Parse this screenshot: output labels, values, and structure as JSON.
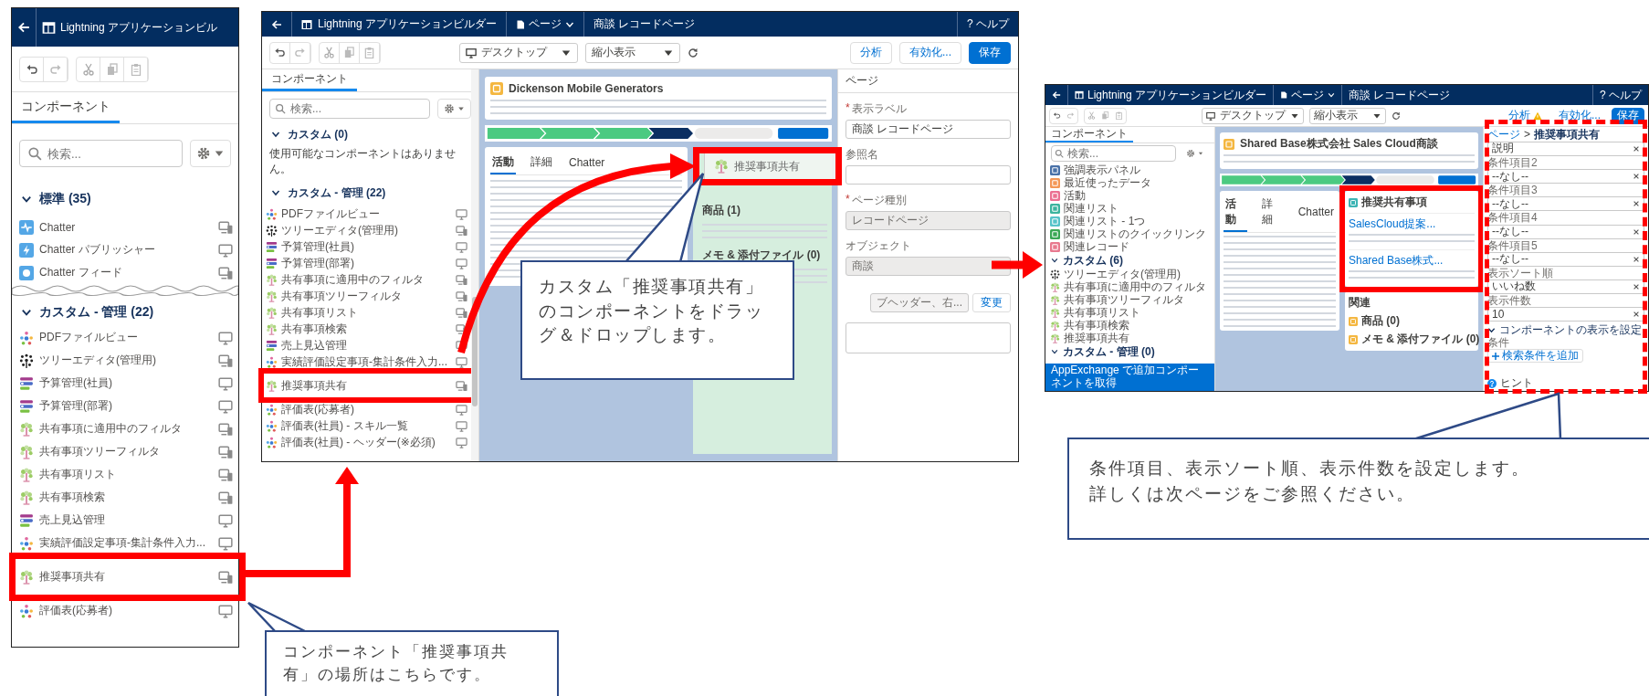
{
  "panel_a": {
    "header": {
      "title": "Lightning アプリケーションビル"
    },
    "tabs": [
      {
        "label": "コンポーネント",
        "selected": true
      }
    ],
    "search": {
      "placeholder": "検索..."
    },
    "sections": [
      {
        "title": "標準 (35)",
        "expanded": true,
        "items": [
          {
            "label": "Chatter",
            "kind": "chatter",
            "mobile": true,
            "highlighted": false
          },
          {
            "label": "Chatter パブリッシャー",
            "kind": "bolt",
            "mobile": false,
            "highlighted": false
          },
          {
            "label": "Chatter フィード",
            "kind": "feed",
            "mobile": true,
            "highlighted": false
          }
        ]
      },
      {
        "title": "カスタム - 管理 (22)",
        "expanded": true,
        "items": [
          {
            "label": "PDFファイルビュー",
            "kind": "org",
            "mobile": false,
            "highlighted": false
          },
          {
            "label": "ツリーエディタ(管理用)",
            "kind": "dots",
            "mobile": true,
            "highlighted": false
          },
          {
            "label": "予算管理(社員)",
            "kind": "bars",
            "mobile": false,
            "highlighted": false
          },
          {
            "label": "予算管理(部署)",
            "kind": "bars",
            "mobile": false,
            "highlighted": false
          },
          {
            "label": "共有事項に適用中のフィルタ",
            "kind": "sprout",
            "mobile": true,
            "highlighted": false
          },
          {
            "label": "共有事項ツリーフィルタ",
            "kind": "sprout",
            "mobile": true,
            "highlighted": false
          },
          {
            "label": "共有事項リスト",
            "kind": "sprout",
            "mobile": true,
            "highlighted": false
          },
          {
            "label": "共有事項検索",
            "kind": "sprout",
            "mobile": true,
            "highlighted": false
          },
          {
            "label": "売上見込管理",
            "kind": "bars",
            "mobile": false,
            "highlighted": false
          },
          {
            "label": "実績評価設定事項-集計条件入力...",
            "kind": "org",
            "mobile": false,
            "highlighted": false
          },
          {
            "label": "推奨事項共有",
            "kind": "sprout",
            "mobile": true,
            "highlighted": true
          },
          {
            "label": "評価表(応募者)",
            "kind": "org",
            "mobile": false,
            "highlighted": false
          }
        ]
      }
    ]
  },
  "panel_b": {
    "header": {
      "app_title": "Lightning アプリケーションビルダー",
      "menu": "ページ",
      "page": "商談 レコードページ",
      "help_icon": "?",
      "help": "ヘルプ"
    },
    "toolbar": {
      "device": "デスクトップ",
      "zoom": "縮小表示",
      "buttons": [
        {
          "label": "分析",
          "kind": "neutral",
          "warning": false
        },
        {
          "label": "有効化...",
          "kind": "neutral",
          "warning": false
        },
        {
          "label": "保存",
          "kind": "brand",
          "warning": false
        }
      ]
    },
    "sidebar": {
      "tabs": [
        {
          "label": "コンポーネント",
          "selected": true
        }
      ],
      "search": {
        "placeholder": "検索..."
      },
      "sections": [
        {
          "title": "カスタム (0)",
          "expanded": true,
          "empty_text": "使用可能なコンポーネントはありません。"
        },
        {
          "title": "カスタム - 管理 (22)",
          "expanded": true,
          "items": [
            {
              "label": "PDFファイルビュー",
              "kind": "org",
              "mobile": false,
              "highlighted": false
            },
            {
              "label": "ツリーエディタ(管理用)",
              "kind": "dots",
              "mobile": true,
              "highlighted": false
            },
            {
              "label": "予算管理(社員)",
              "kind": "bars",
              "mobile": false,
              "highlighted": false
            },
            {
              "label": "予算管理(部署)",
              "kind": "bars",
              "mobile": false,
              "highlighted": false
            },
            {
              "label": "共有事項に適用中のフィルタ",
              "kind": "sprout",
              "mobile": true,
              "highlighted": false
            },
            {
              "label": "共有事項ツリーフィルタ",
              "kind": "sprout",
              "mobile": true,
              "highlighted": false
            },
            {
              "label": "共有事項リスト",
              "kind": "sprout",
              "mobile": true,
              "highlighted": false
            },
            {
              "label": "共有事項検索",
              "kind": "sprout",
              "mobile": true,
              "highlighted": false
            },
            {
              "label": "売上見込管理",
              "kind": "bars",
              "mobile": false,
              "highlighted": false
            },
            {
              "label": "実績評価設定事項-集計条件入力...",
              "kind": "org",
              "mobile": false,
              "highlighted": false
            },
            {
              "label": "推奨事項共有",
              "kind": "sprout",
              "mobile": true,
              "highlighted": true
            },
            {
              "label": "評価表(応募者)",
              "kind": "org",
              "mobile": false,
              "highlighted": false
            },
            {
              "label": "評価表(社員) - スキル一覧",
              "kind": "org",
              "mobile": false,
              "highlighted": false
            },
            {
              "label": "評価表(社員) - ヘッダー(※必須)",
              "kind": "org",
              "mobile": false,
              "highlighted": false
            }
          ]
        }
      ]
    },
    "canvas": {
      "record_title": "Dickenson Mobile Generators",
      "tabs": [
        {
          "label": "活動",
          "selected": true
        },
        {
          "label": "詳細",
          "selected": false
        },
        {
          "label": "Chatter",
          "selected": false
        }
      ],
      "side_cards": [
        {
          "title": "商品 (1)"
        },
        {
          "title": "メモ & 添付ファイル (0)"
        }
      ],
      "drag_ghost": {
        "label": "推奨事項共有",
        "highlighted": true
      }
    },
    "properties": {
      "title": "ページ",
      "fields": [
        {
          "label": "表示ラベル",
          "required_mark": "*",
          "value": "商談 レコードページ",
          "disabled": false
        },
        {
          "label": "参照名",
          "disabled": false
        },
        {
          "label": "ページ種別",
          "required_mark": "*",
          "value": "レコードページ",
          "disabled": true
        },
        {
          "label": "オブジェクト",
          "value": "商談",
          "disabled": true
        }
      ],
      "template": {
        "value": "ブヘッダー、右...",
        "button": "変更"
      }
    }
  },
  "panel_c": {
    "header": {
      "app_title": "Lightning アプリケーションビルダー",
      "menu": "ページ",
      "page": "商談 レコードページ",
      "help_icon": "?",
      "help": "ヘルプ"
    },
    "toolbar": {
      "device": "デスクトップ",
      "zoom": "縮小表示",
      "buttons": [
        {
          "label": "分析",
          "kind": "neutral",
          "warning": true
        },
        {
          "label": "有効化...",
          "kind": "neutral",
          "warning": false
        },
        {
          "label": "保存",
          "kind": "brand",
          "warning": false
        }
      ]
    },
    "sidebar": {
      "tabs": [
        {
          "label": "コンポーネント",
          "selected": true
        }
      ],
      "search": {
        "placeholder": "検索..."
      },
      "standard_items": [
        {
          "label": "強調表示パネル",
          "color": "#4a72a8"
        },
        {
          "label": "最近使ったデータ",
          "color": "#f49756"
        },
        {
          "label": "活動",
          "color": "#eb7092"
        },
        {
          "label": "関連リスト",
          "color": "#3cb49e"
        },
        {
          "label": "関連リスト - 1つ",
          "color": "#56c3c9"
        },
        {
          "label": "関連リストのクイックリンク",
          "color": "#3ba755"
        },
        {
          "label": "関連レコード",
          "color": "#e8798f"
        }
      ],
      "sections": [
        {
          "title": "カスタム (6)",
          "expanded": true,
          "items": [
            {
              "label": "ツリーエディタ(管理用)",
              "kind": "dots"
            },
            {
              "label": "共有事項に適用中のフィルタ",
              "kind": "sprout"
            },
            {
              "label": "共有事項ツリーフィルタ",
              "kind": "sprout"
            },
            {
              "label": "共有事項リスト",
              "kind": "sprout"
            },
            {
              "label": "共有事項検索",
              "kind": "sprout"
            },
            {
              "label": "推奨事項共有",
              "kind": "sprout"
            }
          ]
        },
        {
          "title": "カスタム - 管理 (0)",
          "expanded": true
        }
      ],
      "footer": "AppExchange で追加コンポーネントを取得"
    },
    "canvas": {
      "record_title": "Shared Base株式会社 Sales Cloud商談",
      "tabs": [
        {
          "label": "活動",
          "selected": true
        },
        {
          "label": "詳細",
          "selected": false
        },
        {
          "label": "Chatter",
          "selected": false
        }
      ],
      "recommend_card": {
        "title": "推奨共有事項",
        "highlighted": true,
        "items": [
          {
            "title": "SalesCloud提案..."
          },
          {
            "title": "Shared Base株式..."
          }
        ]
      },
      "related": {
        "title": "関連",
        "items": [
          {
            "title": "商品 (0)"
          },
          {
            "title": "メモ & 添付ファイル (0)"
          }
        ]
      }
    },
    "properties": {
      "highlighted": true,
      "breadcrumb": {
        "parent": "ページ",
        "separator": ">",
        "current": "推奨事項共有"
      },
      "fields": [
        {
          "value": "説明"
        },
        {
          "label": "条件項目2",
          "value": "--なし--"
        },
        {
          "label": "条件項目3",
          "value": "--なし--"
        },
        {
          "label": "条件項目4",
          "value": "--なし--"
        },
        {
          "label": "条件項目5",
          "value": "--なし--"
        },
        {
          "label": "表示ソート順",
          "value": "いいね数"
        },
        {
          "label": "表示件数",
          "value": "10"
        }
      ],
      "visibility": {
        "title": "コンポーネントの表示を設定",
        "expanded": true,
        "label": "条件",
        "button": "検索条件を追加"
      },
      "hint": "ヒント"
    }
  },
  "callouts": [
    {
      "text": "カスタム「推奨事項共有」のコンポーネントをドラッグ＆ドロップします。"
    },
    {
      "text": "条件項目、表示ソート順、表示件数を設定します。詳しくは次ページをご参照ください。"
    },
    {
      "text": "コンポーネント「推奨事項共有」の場所はこちらです。"
    }
  ]
}
